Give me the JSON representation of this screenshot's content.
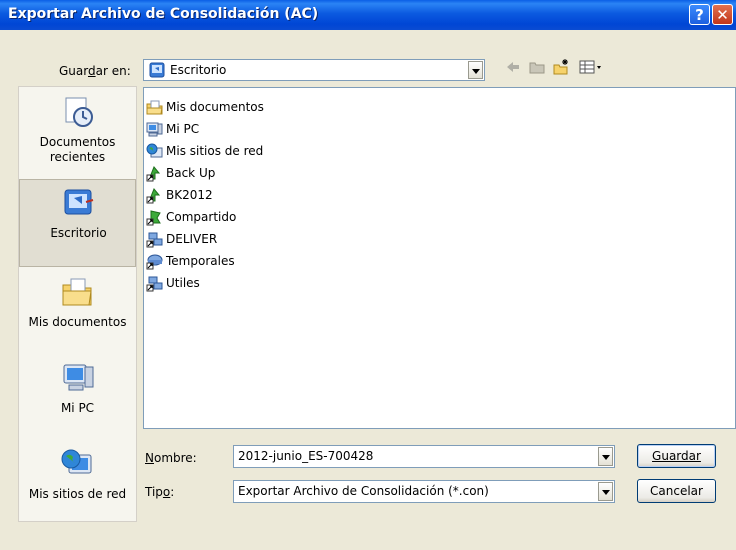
{
  "window": {
    "title": "Exportar Archivo de Consolidación (AC)"
  },
  "save_in": {
    "label": "Guardar en:",
    "value": "Escritorio",
    "icon": "desktop-icon"
  },
  "toolbar": {
    "back_icon": "back-arrow-icon",
    "up_icon": "up-folder-icon",
    "new_folder_icon": "new-folder-icon",
    "views_icon": "views-menu-icon"
  },
  "places": [
    {
      "label": "Documentos recientes",
      "icon": "recent-documents-icon",
      "selected": false
    },
    {
      "label": "Escritorio",
      "icon": "desktop-icon",
      "selected": true
    },
    {
      "label": "Mis documentos",
      "icon": "my-documents-icon",
      "selected": false
    },
    {
      "label": "Mi PC",
      "icon": "my-computer-icon",
      "selected": false
    },
    {
      "label": "Mis sitios de red",
      "icon": "network-places-icon",
      "selected": false
    }
  ],
  "files": [
    {
      "name": "Mis documentos",
      "icon": "my-documents-folder-icon"
    },
    {
      "name": "Mi PC",
      "icon": "my-computer-icon"
    },
    {
      "name": "Mis sitios de red",
      "icon": "network-places-icon"
    },
    {
      "name": "Back Up",
      "icon": "shortcut-icon"
    },
    {
      "name": "BK2012",
      "icon": "shortcut-icon"
    },
    {
      "name": "Compartido",
      "icon": "shared-shortcut-icon"
    },
    {
      "name": "DELIVER",
      "icon": "network-shortcut-icon"
    },
    {
      "name": "Temporales",
      "icon": "drive-shortcut-icon"
    },
    {
      "name": "Utiles",
      "icon": "network-shortcut-icon"
    }
  ],
  "filename": {
    "label": "Nombre:",
    "value": "2012-junio_ES-700428"
  },
  "filetype": {
    "label": "Tipo:",
    "value": "Exportar Archivo de Consolidación (*.con)"
  },
  "buttons": {
    "save": "Guardar",
    "cancel": "Cancelar"
  }
}
